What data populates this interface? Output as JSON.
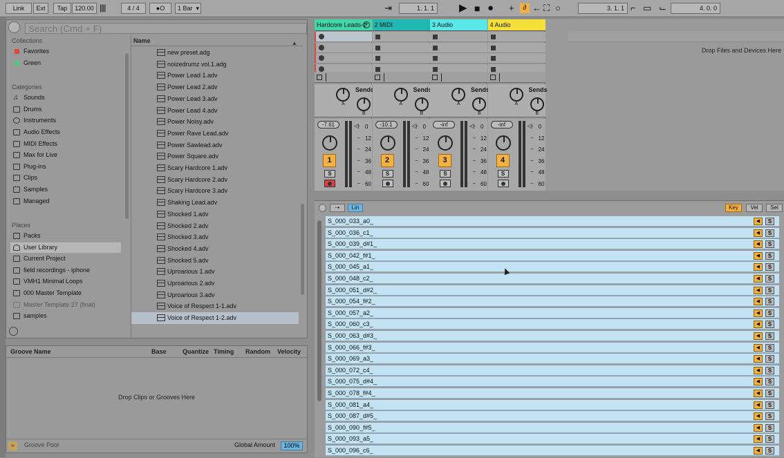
{
  "topbar": {
    "link": "Link",
    "ext": "Ext",
    "tap": "Tap",
    "tempo": "120.00",
    "time_sig": "4 / 4",
    "metronome": "●O",
    "quantize": "1 Bar",
    "arrangement_pos": "1.   1.   1",
    "punch_pos": "3.   1.   1",
    "loop_len": "4.   0.   0"
  },
  "browser": {
    "search_placeholder": "Search (Cmd + F)",
    "collections_label": "Collections",
    "collections": [
      {
        "label": "Favorites",
        "color": "#d94c3a"
      },
      {
        "label": "Green",
        "color": "#4fc97a"
      }
    ],
    "categories_label": "Categories",
    "categories": [
      "Sounds",
      "Drums",
      "Instruments",
      "Audio Effects",
      "MIDI Effects",
      "Max for Live",
      "Plug-ins",
      "Clips",
      "Samples",
      "Managed"
    ],
    "places_label": "Places",
    "places": [
      "Packs",
      "User Library",
      "Current Project",
      "field recordings - iphone",
      "VMH1 Minimal Loops",
      "000 Master Template",
      "Master Template 27 (final)",
      "samples"
    ],
    "name_header": "Name",
    "files": [
      "new preset.adg",
      "noizedrumz vol.1.adg",
      "Power Lead 1.adv",
      "Power Lead 2.adv",
      "Power Lead 3.adv",
      "Power Lead 4.adv",
      "Power Noisy.adv",
      "Power Rave Lead.adv",
      "Power Sawlead.adv",
      "Power Square.adv",
      "Scary Hardcore 1.adv",
      "Scary Hardcore 2.adv",
      "Scary Hardcore 3.adv",
      "Shaking Lead.adv",
      "Shocked 1.adv",
      "Shocked 2.adv",
      "Shocked 3.adv",
      "Shocked 4.adv",
      "Shocked 5.adv",
      "Uproarious 1.adv",
      "Uproarious 2.adv",
      "Uproarious 3.adv",
      "Voice of Respect 1-1.adv",
      "Voice of Respect 1-2.adv"
    ]
  },
  "groove": {
    "col_name": "Groove Name",
    "col_base": "Base",
    "col_quantize": "Quantize",
    "col_timing": "Timing",
    "col_random": "Random",
    "col_velocity": "Velocity",
    "drop_text": "Drop Clips or Grooves Here",
    "pool_label": "Groove Pool",
    "amount_label": "Global Amount",
    "amount_value": "100%"
  },
  "session": {
    "drop_text": "Drop Files and Devices Here",
    "sends_label": "Sends",
    "knob_a": "A",
    "knob_b": "B",
    "solo_label": "S",
    "scale": [
      "0",
      "12",
      "24",
      "36",
      "48",
      "60"
    ],
    "tracks": [
      {
        "name": "Hardcore Leads-1",
        "color": "#3fd6a8",
        "volume": "-7.61",
        "number": "1",
        "armed": true
      },
      {
        "name": "2 MIDI",
        "color": "#1fb9b1",
        "volume": "-10.1",
        "number": "2",
        "armed": false
      },
      {
        "name": "3 Audio",
        "color": "#57e7e7",
        "volume": "-inf",
        "number": "3",
        "armed": false
      },
      {
        "name": "4 Audio",
        "color": "#f5e03a",
        "volume": "-inf",
        "number": "4",
        "armed": false
      }
    ]
  },
  "detail": {
    "lin_label": "Lin",
    "key_label": "Key",
    "vel_label": "Vel",
    "sel_label": "Sel",
    "solo_label": "S",
    "pads": [
      "S_000_033_a0_",
      "S_000_036_c1_",
      "S_000_039_d#1_",
      "S_000_042_f#1_",
      "S_000_045_a1_",
      "S_000_048_c2_",
      "S_000_051_d#2_",
      "S_000_054_f#2_",
      "S_000_057_a2_",
      "S_000_060_c3_",
      "S_000_063_d#3_",
      "S_000_066_f#3_",
      "S_000_069_a3_",
      "S_000_072_c4_",
      "S_000_075_d#4_",
      "S_000_078_f#4_",
      "S_000_081_a4_",
      "S_000_087_d#5_",
      "S_000_090_f#5_",
      "S_000_093_a5_",
      "S_000_096_c6_"
    ]
  }
}
